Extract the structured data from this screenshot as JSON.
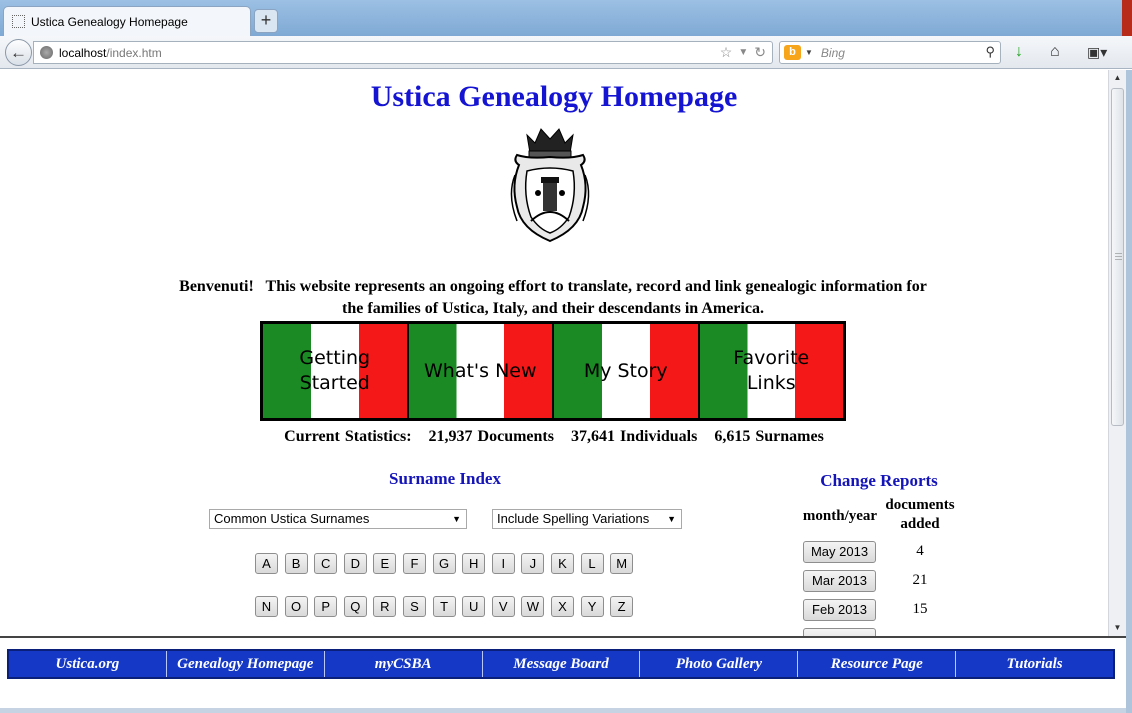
{
  "browser": {
    "tab_title": "Ustica Genealogy Homepage",
    "new_tab": "+",
    "url_host": "localhost",
    "url_path": "/index.htm",
    "search_placeholder": "Bing",
    "icons": {
      "back": "back-arrow-icon",
      "bookmark": "star-icon",
      "reload": "reload-icon",
      "download": "download-arrow-icon",
      "home": "home-icon",
      "addon": "addon-menu-icon"
    }
  },
  "page": {
    "title": "Ustica Genealogy Homepage",
    "welcome_line1": "Benvenuti!   This website represents an ongoing effort to translate, record and link genealogic information for",
    "welcome_line2": "the families of Ustica, Italy, and their descendants in America.",
    "nav_boxes": [
      {
        "line1": "Getting",
        "line2": "Started"
      },
      {
        "line1": "What's New",
        "line2": ""
      },
      {
        "line1": "My Story",
        "line2": ""
      },
      {
        "line1": "Favorite",
        "line2": "Links"
      }
    ],
    "stats": {
      "label": "Current Statistics:",
      "documents": "21,937 Documents",
      "individuals": "37,641 Individuals",
      "surnames": "6,615 Surnames"
    },
    "surname_index": {
      "title": "Surname Index",
      "select_surnames": "Common Ustica Surnames",
      "select_variations": "Include Spelling Variations",
      "row1": [
        "A",
        "B",
        "C",
        "D",
        "E",
        "F",
        "G",
        "H",
        "I",
        "J",
        "K",
        "L",
        "M"
      ],
      "row2": [
        "N",
        "O",
        "P",
        "Q",
        "R",
        "S",
        "T",
        "U",
        "V",
        "W",
        "X",
        "Y",
        "Z"
      ]
    },
    "change_reports": {
      "title": "Change Reports",
      "col_month": "month/year",
      "col_docs_line1": "documents",
      "col_docs_line2": "added",
      "rows": [
        {
          "month": "May 2013",
          "count": "4"
        },
        {
          "month": "Mar 2013",
          "count": "21"
        },
        {
          "month": "Feb 2013",
          "count": "15"
        }
      ]
    }
  },
  "bottom_nav": [
    "Ustica.org",
    "Genealogy Homepage",
    "myCSBA",
    "Message Board",
    "Photo Gallery",
    "Resource Page",
    "Tutorials"
  ],
  "colors": {
    "title_blue": "#1414d2",
    "flag_green": "#1b8a24",
    "flag_white": "#ffffff",
    "flag_red": "#f51818",
    "nav_bar_blue": "#1538c7"
  }
}
